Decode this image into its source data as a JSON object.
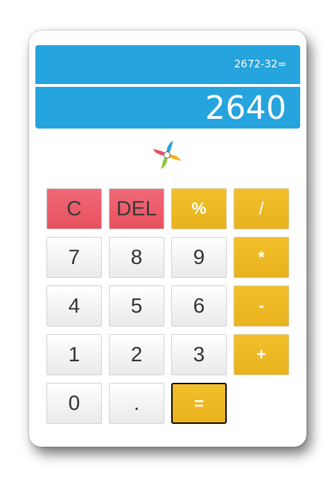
{
  "display": {
    "expression": "2672-32=",
    "result": "2640"
  },
  "logo": {
    "icon": "pinwheel-logo",
    "colors": [
      "#e8505f",
      "#25a4de",
      "#f2b51e",
      "#8cc63f"
    ]
  },
  "keys": {
    "clear": "C",
    "del": "DEL",
    "percent": "%",
    "divide": "/",
    "seven": "7",
    "eight": "8",
    "nine": "9",
    "multiply": "*",
    "four": "4",
    "five": "5",
    "six": "6",
    "minus": "-",
    "one": "1",
    "two": "2",
    "three": "3",
    "plus": "+",
    "zero": "0",
    "dot": ".",
    "equals": "="
  },
  "colors": {
    "display_bg": "#25a4de",
    "operator": "#f2c02c",
    "clear": "#e8505f"
  }
}
